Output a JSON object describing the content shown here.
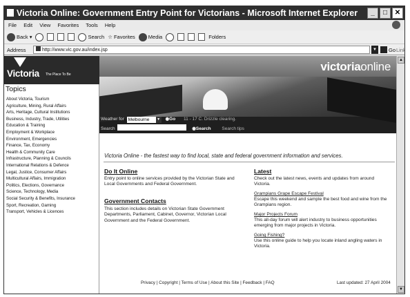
{
  "window": {
    "title": "Victoria Online: Government Entry Point for Victorians - Microsoft Internet Explorer"
  },
  "menubar": [
    "File",
    "Edit",
    "View",
    "Favorites",
    "Tools",
    "Help"
  ],
  "toolbar": {
    "back": "Back",
    "search": "Search",
    "favorites": "Favorites",
    "media": "Media",
    "folders": "Folders"
  },
  "address": {
    "label": "Address",
    "url": "http://www.vic.gov.au/index.jsp",
    "go": "Go",
    "links": "Links"
  },
  "sidebar": {
    "logo_word": "Victoria",
    "logo_tagline": "The Place To Be",
    "topics_heading": "Topics",
    "topics": [
      "About Victoria, Tourism",
      "Agriculture, Mining, Rural Affairs",
      "Arts, Heritage, Cultural Institutions",
      "Business, Industry, Trade, Utilities",
      "Education & Training",
      "Employment & Workplace",
      "Environment, Emergencies",
      "Finance, Tax, Economy",
      "Health & Community Care",
      "Infrastructure, Planning & Councils",
      "International Relations & Defence",
      "Legal, Justice, Consumer Affairs",
      "Multicultural Affairs, Immigration",
      "Politics, Elections, Governance",
      "Science, Technology, Media",
      "Social Security & Benefits, Insurance",
      "Sport, Recreation, Gaming",
      "Transport, Vehicles & Licences"
    ]
  },
  "banner": {
    "brand_bold": "victoria",
    "brand_rest": "online",
    "weather_label": "Weather for",
    "weather_city": "Melbourne",
    "go": "Go",
    "weather_text": "11 - 17 C. Drizzle clearing.",
    "search_label": "Search",
    "search_button": "Search",
    "search_tips": "Search tips"
  },
  "main": {
    "tagline": "Victoria Online - the fastest way to find local, state and federal government information and services.",
    "do_it_online": {
      "heading": "Do It Online",
      "text": "Entry point to online services provided by the Victorian State and Local Governments and Federal Government."
    },
    "government_contacts": {
      "heading": "Government Contacts",
      "text": "This section includes details on Victorian State Government Departments, Parliament, Cabinet, Governor, Victorian Local Government and the Federal Government."
    },
    "latest": {
      "heading": "Latest",
      "intro": "Check out the latest news, events and updates from around Victoria.",
      "items": [
        {
          "title": "Grampians Grape Escape Festival",
          "text": "Escape this weekend and sample the best food and wine from the Grampians region."
        },
        {
          "title": "Major Projects Forum",
          "text": "This all-day forum will alert industry to business opportunities emerging from major projects in Victoria."
        },
        {
          "title": "Going Fishing?",
          "text": "Use this online guide to help you locate inland angling waters in Victoria."
        }
      ]
    }
  },
  "footer": {
    "links": "Privacy | Copyright | Terms of Use | About this Site | Feedback | FAQ",
    "updated": "Last updated: 27 April 2004"
  }
}
